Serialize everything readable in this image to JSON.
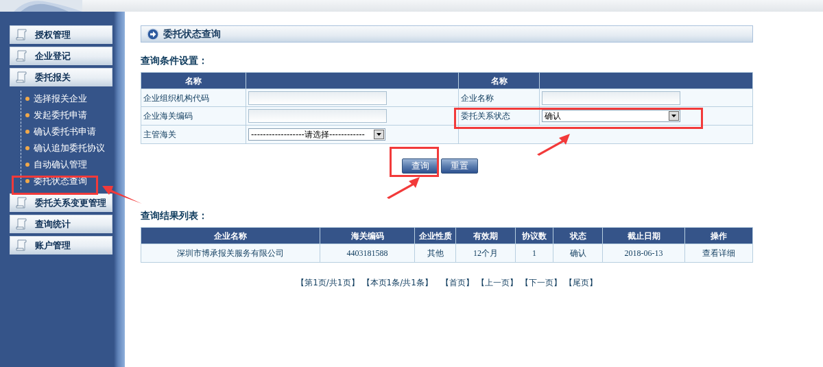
{
  "sidebar": {
    "items": [
      {
        "label": "授权管理"
      },
      {
        "label": "企业登记"
      },
      {
        "label": "委托报关",
        "children": [
          {
            "label": "选择报关企业",
            "highlighted": false
          },
          {
            "label": "发起委托申请",
            "highlighted": false
          },
          {
            "label": "确认委托书申请",
            "highlighted": false
          },
          {
            "label": "确认追加委托协议",
            "highlighted": false
          },
          {
            "label": "自动确认管理",
            "highlighted": false
          },
          {
            "label": "委托状态查询",
            "highlighted": true
          }
        ]
      },
      {
        "label": "委托关系变更管理"
      },
      {
        "label": "查询统计"
      },
      {
        "label": "账户管理"
      }
    ]
  },
  "page_title": "委托状态查询",
  "query": {
    "heading": "查询条件设置：",
    "columns": [
      "名称",
      "名称"
    ],
    "left": [
      {
        "label": "企业组织机构代码",
        "kind": "text"
      },
      {
        "label": "企业海关编码",
        "kind": "text"
      },
      {
        "label": "主管海关",
        "kind": "select",
        "value": "------------------请选择------------",
        "highlighted": false
      }
    ],
    "right": [
      {
        "label": "企业名称",
        "kind": "text"
      },
      {
        "label": "委托关系状态",
        "kind": "select",
        "value": "确认",
        "highlighted": true
      }
    ],
    "buttons": [
      {
        "label": "查询",
        "highlighted": true
      },
      {
        "label": "重置",
        "highlighted": false
      }
    ]
  },
  "results": {
    "heading": "查询结果列表：",
    "columns": [
      "企业名称",
      "海关编码",
      "企业性质",
      "有效期",
      "协议数",
      "状态",
      "截止日期",
      "操作"
    ],
    "rows": [
      [
        "深圳市博承报关服务有限公司",
        "4403181588",
        "其他",
        "12个月",
        "1",
        "确认",
        "2018-06-13",
        "查看详细"
      ]
    ],
    "pagination": [
      "【第1页/共1页】",
      "【本页1条/共1条】",
      "【首页】",
      "【上一页】",
      "【下一页】",
      "【尾页】"
    ]
  }
}
